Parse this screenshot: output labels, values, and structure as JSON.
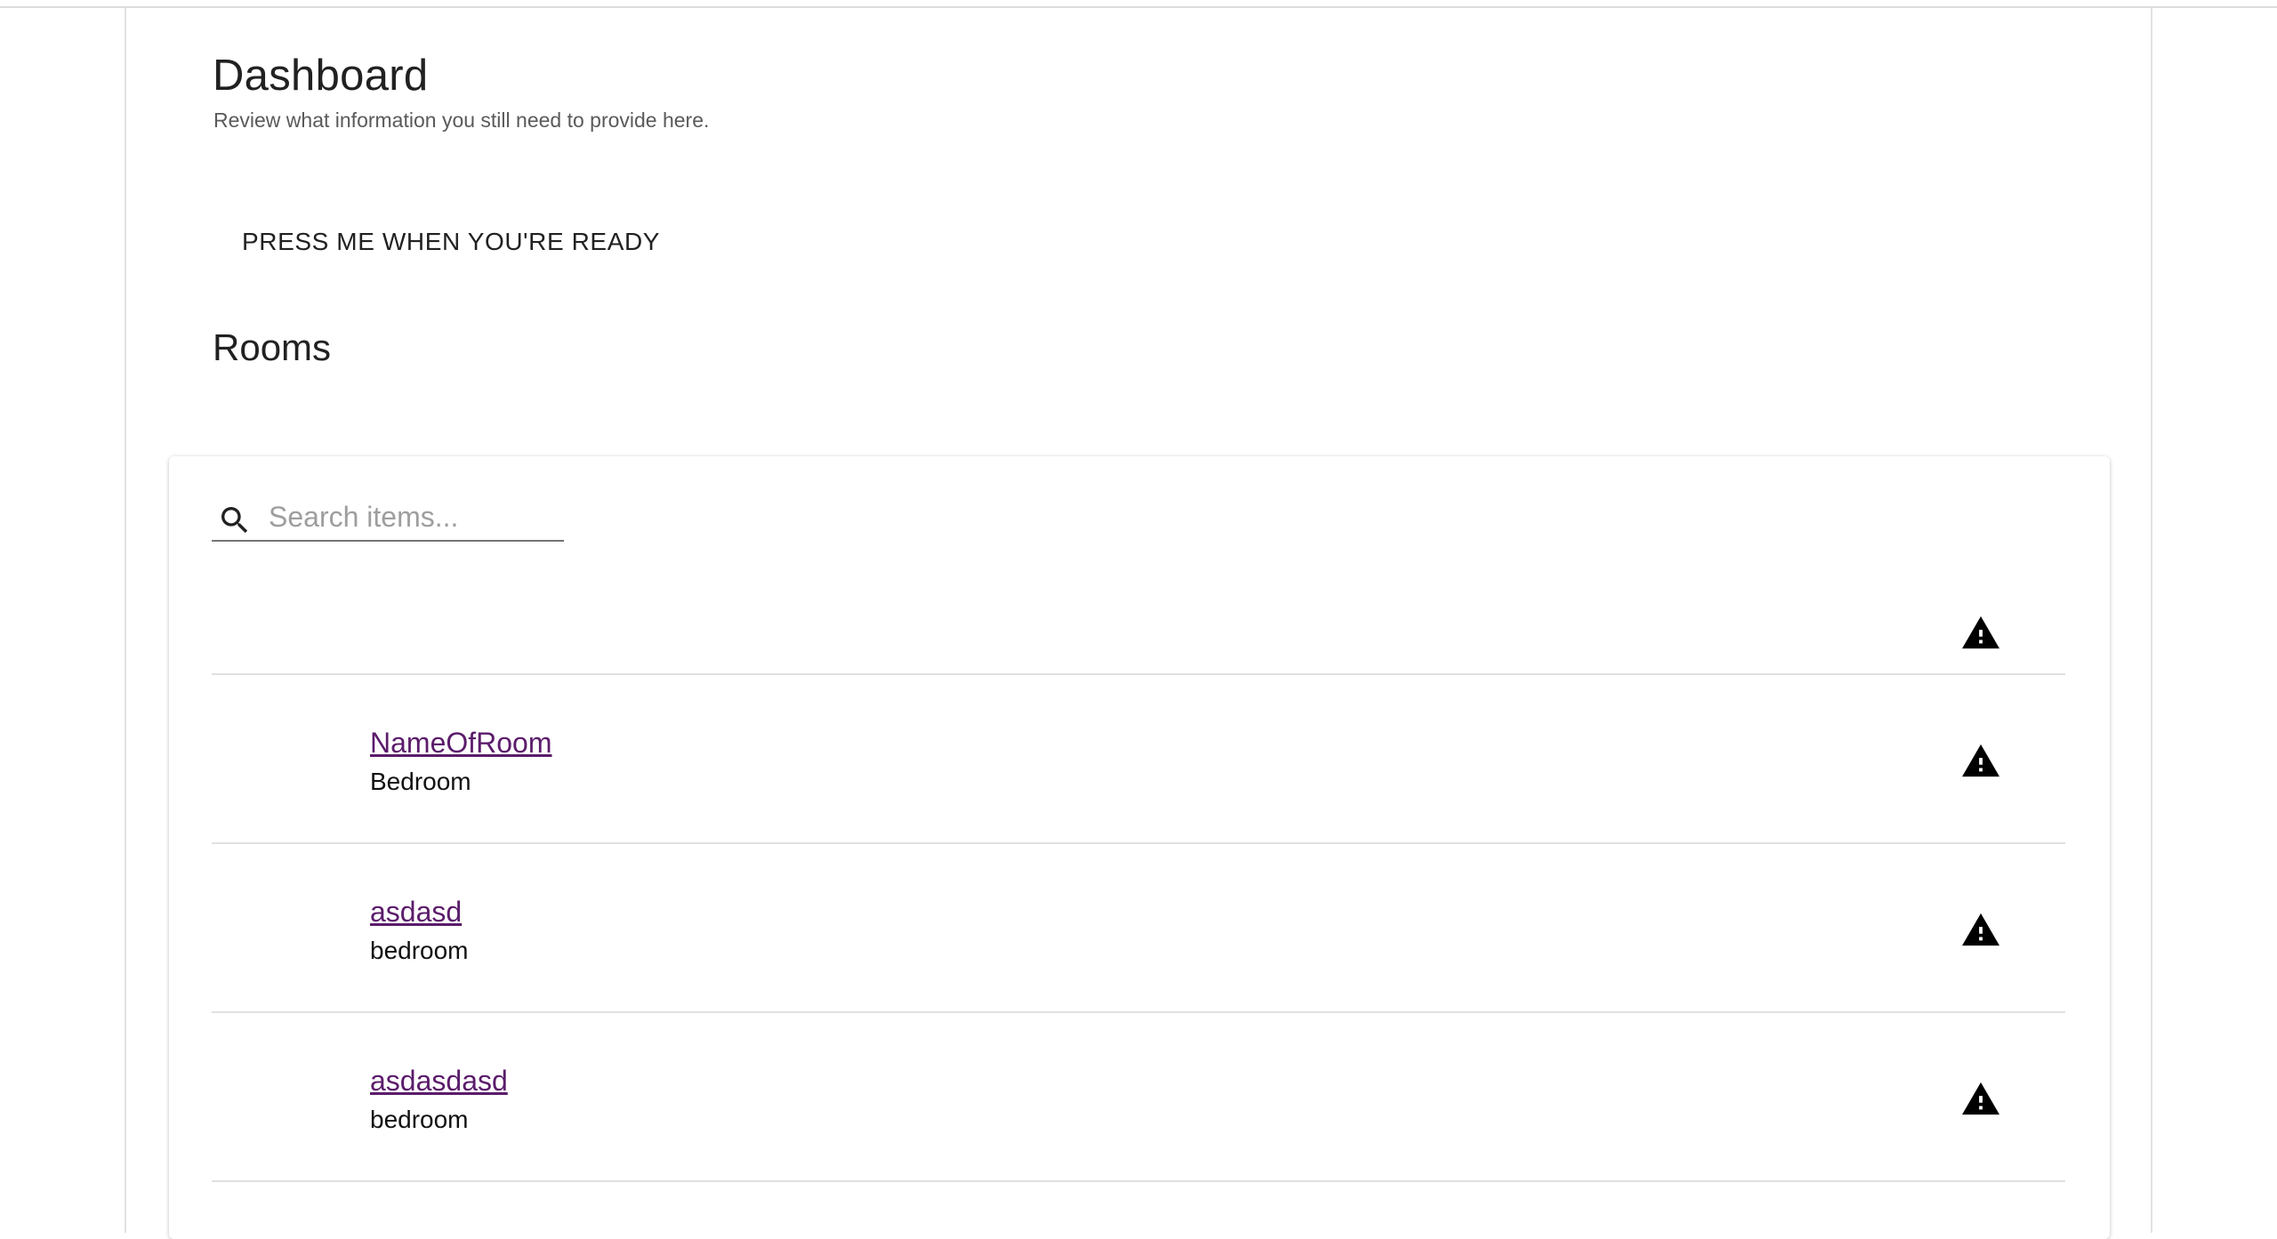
{
  "header": {
    "title": "Dashboard",
    "subtitle": "Review what information you still need to provide here."
  },
  "ready_button": {
    "label": "PRESS ME WHEN YOU'RE READY"
  },
  "rooms": {
    "section_title": "Rooms",
    "search": {
      "placeholder": "Search items...",
      "value": ""
    },
    "header_icon": "warning-icon",
    "items": [
      {
        "name": "NameOfRoom",
        "type": "Bedroom",
        "status_icon": "warning-icon"
      },
      {
        "name": "asdasd",
        "type": "bedroom",
        "status_icon": "warning-icon"
      },
      {
        "name": "asdasdasd",
        "type": "bedroom",
        "status_icon": "warning-icon"
      }
    ]
  },
  "colors": {
    "link": "#5b1c6b",
    "text": "#212121",
    "muted": "#5a5a5a",
    "divider": "#e0e0e0"
  }
}
